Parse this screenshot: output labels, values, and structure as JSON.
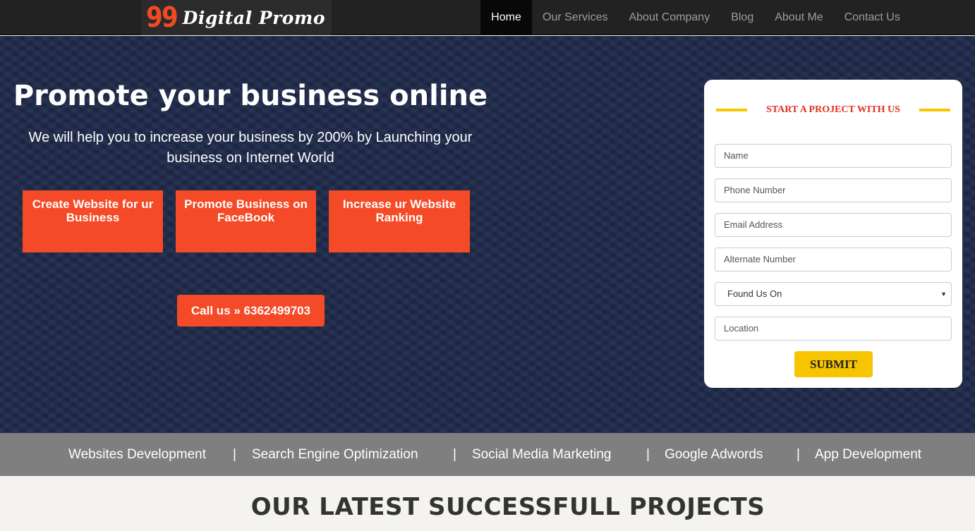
{
  "brand": {
    "number": "99",
    "name": "Digital Promo"
  },
  "nav": {
    "items": [
      {
        "label": "Home",
        "active": true
      },
      {
        "label": "Our Services"
      },
      {
        "label": "About Company"
      },
      {
        "label": "Blog"
      },
      {
        "label": "About Me"
      },
      {
        "label": "Contact Us"
      }
    ]
  },
  "hero": {
    "title": "Promote your business online",
    "subtitle": "We will help you to increase your business by 200% by Launching your business on Internet World",
    "buttons": [
      "Create Website for ur Business",
      "Promote Business on FaceBook",
      "Increase ur Website Ranking"
    ],
    "call_label": "Call us » 6362499703"
  },
  "form": {
    "title": "START A PROJECT WITH US",
    "name_placeholder": "Name",
    "phone_placeholder": "Phone Number",
    "email_placeholder": "Email Address",
    "alt_placeholder": "Alternate Number",
    "found_us_selected": "Found Us On",
    "location_placeholder": "Location",
    "submit_label": "SUBMIT"
  },
  "services_strip": [
    "Websites Development",
    "|",
    "Search Engine Optimization",
    "|",
    "Social Media Marketing",
    "|",
    "Google Adwords",
    "|",
    "App Development"
  ],
  "projects": {
    "title": "OUR LATEST SUCCESSFULL PROJECTS"
  },
  "colors": {
    "accent": "#f54a27",
    "navy": "#1f2a4a",
    "yellow": "#f7c400",
    "strip": "#7f7f7f"
  }
}
